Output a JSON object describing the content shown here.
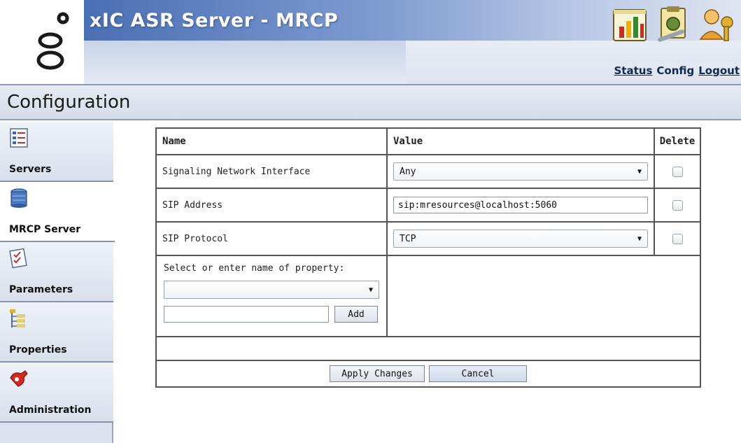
{
  "app": {
    "title": "xIC ASR Server - MRCP"
  },
  "header": {
    "icons": [
      "status-chart-icon",
      "config-tools-icon",
      "logout-key-user-icon"
    ],
    "links": {
      "status": "Status",
      "config": "Config",
      "logout": "Logout"
    }
  },
  "section": {
    "title": "Configuration"
  },
  "sidebar": {
    "items": [
      {
        "label": "Servers",
        "icon": "servers-checklist-icon",
        "active": false
      },
      {
        "label": "MRCP Server",
        "icon": "mrcp-server-database-icon",
        "active": true
      },
      {
        "label": "Parameters",
        "icon": "parameters-document-icon",
        "active": false
      },
      {
        "label": "Properties",
        "icon": "properties-tree-icon",
        "active": false
      },
      {
        "label": "Administration",
        "icon": "administration-tools-icon",
        "active": false
      }
    ]
  },
  "table": {
    "headers": {
      "name": "Name",
      "value": "Value",
      "delete": "Delete"
    },
    "rows": [
      {
        "name": "Signaling Network Interface",
        "value": "Any",
        "control": "select",
        "delete_checked": false
      },
      {
        "name": "SIP Address",
        "value": "sip:mresources@localhost:5060",
        "control": "text",
        "delete_checked": false
      },
      {
        "name": "SIP Protocol",
        "value": "TCP",
        "control": "select",
        "delete_checked": false
      }
    ],
    "add_property": {
      "label": "Select or enter name of property:",
      "select_value": "",
      "input_value": "",
      "add_button": "Add"
    },
    "footer": {
      "apply_button": "Apply Changes",
      "cancel_button": "Cancel"
    }
  },
  "colors": {
    "title_band": "#4a6fb3",
    "header_bg": "#e4e9f3",
    "sidebar_bg": "#dce3ee",
    "border": "#555555"
  }
}
